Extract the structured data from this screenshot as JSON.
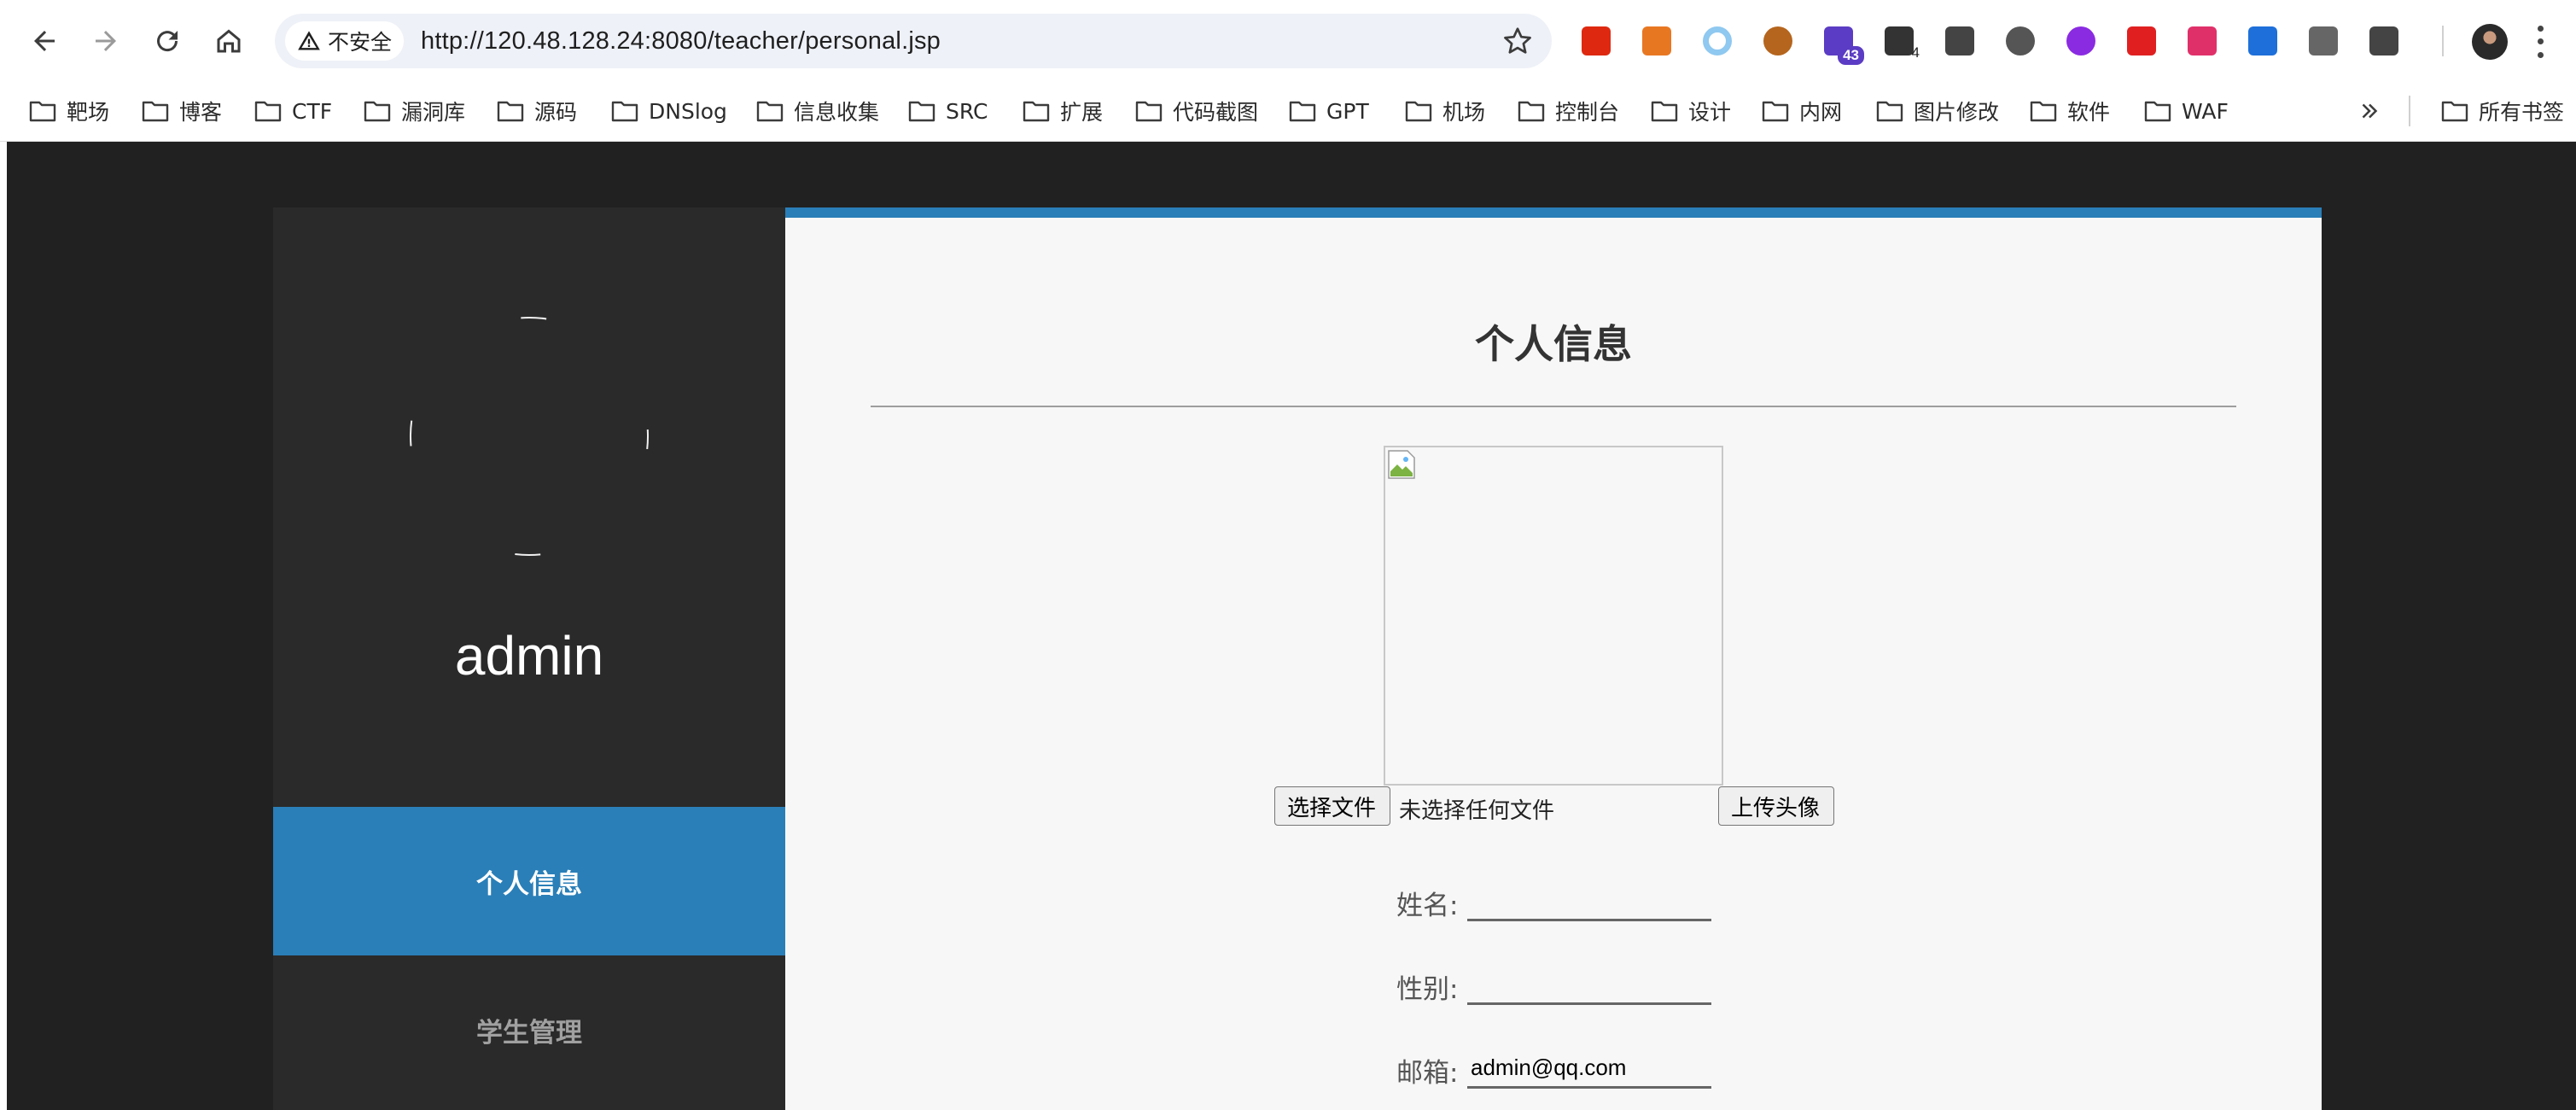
{
  "browser": {
    "security_label": "不安全",
    "url": "http://120.48.128.24:8080/teacher/personal.jsp",
    "extensions": [
      {
        "name": "china-flag-ext",
        "color": "#de2910"
      },
      {
        "name": "pilcrow-ext",
        "color": "#e87722"
      },
      {
        "name": "ring-ext",
        "color": "#8fc8f0"
      },
      {
        "name": "cookie-ext",
        "color": "#b5651d"
      },
      {
        "name": "graduation-cap-ext",
        "color": "#5b3cc4",
        "badge": "43"
      },
      {
        "name": "panda-ext",
        "color": "#333333",
        "badge": "4"
      },
      {
        "name": "hat-ext",
        "color": "#444444"
      },
      {
        "name": "eye-ext",
        "color": "#555555"
      },
      {
        "name": "moon-ext",
        "color": "#8a2be2"
      },
      {
        "name": "fe-ext",
        "color": "#e02020"
      },
      {
        "name": "translate-ext",
        "color": "#e0306a"
      },
      {
        "name": "bird-ext",
        "color": "#1e6fd9"
      },
      {
        "name": "gear-ext",
        "color": "#666666"
      },
      {
        "name": "puzzle-ext",
        "color": "#444444"
      }
    ]
  },
  "bookmarks": {
    "items": [
      "靶场",
      "博客",
      "CTF",
      "漏洞库",
      "源码",
      "DNSlog",
      "信息收集",
      "SRC",
      "扩展",
      "代码截图",
      "GPT",
      "机场",
      "控制台",
      "设计",
      "内网",
      "图片修改",
      "软件",
      "WAF"
    ],
    "all_bookmarks": "所有书签"
  },
  "sidebar": {
    "username": "admin",
    "items": [
      {
        "label": "个人信息",
        "active": true
      },
      {
        "label": "学生管理",
        "active": false
      }
    ]
  },
  "main": {
    "title": "个人信息",
    "upload": {
      "choose_label": "选择文件",
      "no_file_text": "未选择任何文件",
      "upload_label": "上传头像"
    },
    "fields": {
      "name_label": "姓名:",
      "name_value": "",
      "gender_label": "性别:",
      "gender_value": "",
      "email_label": "邮箱:",
      "email_value": "admin@qq.com"
    }
  },
  "colors": {
    "accent": "#2a7fb8",
    "page_bg": "#212121",
    "sidebar_bg": "#2a2a2a",
    "content_bg": "#f7f7f7"
  }
}
